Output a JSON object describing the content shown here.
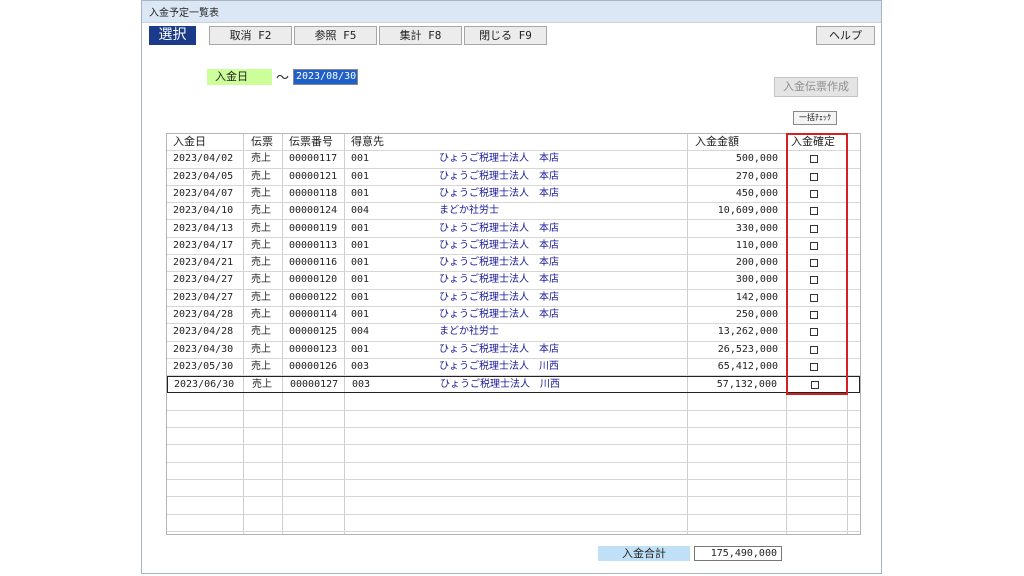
{
  "window": {
    "title": "入金予定一覧表"
  },
  "toolbar": {
    "mode_label": "選択",
    "buttons": [
      "取消 F2",
      "参照 F5",
      "集計 F8",
      "閉じる F9"
    ],
    "help_label": "ヘルプ"
  },
  "filter": {
    "label": "入金日",
    "separator": "～",
    "value": "2023/08/30"
  },
  "actions": {
    "create_label": "入金伝票作成",
    "bulk_check_label": "一括ﾁｪｯｸ"
  },
  "table": {
    "headers": {
      "date": "入金日",
      "type": "伝票",
      "slip": "伝票番号",
      "client": "得意先",
      "amount": "入金金額",
      "confirm": "入金確定"
    },
    "rows": [
      {
        "date": "2023/04/02",
        "type": "売上",
        "slip": "00000117",
        "code": "001",
        "name": "ひょうご税理士法人　本店",
        "amount": "500,000",
        "confirmed": false
      },
      {
        "date": "2023/04/05",
        "type": "売上",
        "slip": "00000121",
        "code": "001",
        "name": "ひょうご税理士法人　本店",
        "amount": "270,000",
        "confirmed": false
      },
      {
        "date": "2023/04/07",
        "type": "売上",
        "slip": "00000118",
        "code": "001",
        "name": "ひょうご税理士法人　本店",
        "amount": "450,000",
        "confirmed": false
      },
      {
        "date": "2023/04/10",
        "type": "売上",
        "slip": "00000124",
        "code": "004",
        "name": "まどか社労士",
        "amount": "10,609,000",
        "confirmed": false
      },
      {
        "date": "2023/04/13",
        "type": "売上",
        "slip": "00000119",
        "code": "001",
        "name": "ひょうご税理士法人　本店",
        "amount": "330,000",
        "confirmed": false
      },
      {
        "date": "2023/04/17",
        "type": "売上",
        "slip": "00000113",
        "code": "001",
        "name": "ひょうご税理士法人　本店",
        "amount": "110,000",
        "confirmed": false
      },
      {
        "date": "2023/04/21",
        "type": "売上",
        "slip": "00000116",
        "code": "001",
        "name": "ひょうご税理士法人　本店",
        "amount": "200,000",
        "confirmed": false
      },
      {
        "date": "2023/04/27",
        "type": "売上",
        "slip": "00000120",
        "code": "001",
        "name": "ひょうご税理士法人　本店",
        "amount": "300,000",
        "confirmed": false
      },
      {
        "date": "2023/04/27",
        "type": "売上",
        "slip": "00000122",
        "code": "001",
        "name": "ひょうご税理士法人　本店",
        "amount": "142,000",
        "confirmed": false
      },
      {
        "date": "2023/04/28",
        "type": "売上",
        "slip": "00000114",
        "code": "001",
        "name": "ひょうご税理士法人　本店",
        "amount": "250,000",
        "confirmed": false
      },
      {
        "date": "2023/04/28",
        "type": "売上",
        "slip": "00000125",
        "code": "004",
        "name": "まどか社労士",
        "amount": "13,262,000",
        "confirmed": false
      },
      {
        "date": "2023/04/30",
        "type": "売上",
        "slip": "00000123",
        "code": "001",
        "name": "ひょうご税理士法人　本店",
        "amount": "26,523,000",
        "confirmed": false
      },
      {
        "date": "2023/05/30",
        "type": "売上",
        "slip": "00000126",
        "code": "003",
        "name": "ひょうご税理士法人　川西",
        "amount": "65,412,000",
        "confirmed": false
      },
      {
        "date": "2023/06/30",
        "type": "売上",
        "slip": "00000127",
        "code": "003",
        "name": "ひょうご税理士法人　川西",
        "amount": "57,132,000",
        "confirmed": false
      }
    ]
  },
  "totals": {
    "label": "入金合計",
    "value": "175,490,000"
  },
  "colors": {
    "mode_button": "#1b3a8a",
    "date_label_bg": "#ccff99",
    "highlight_box": "#d42020",
    "total_label_bg": "#bfe0f7",
    "client_text": "#1a1a9c"
  }
}
